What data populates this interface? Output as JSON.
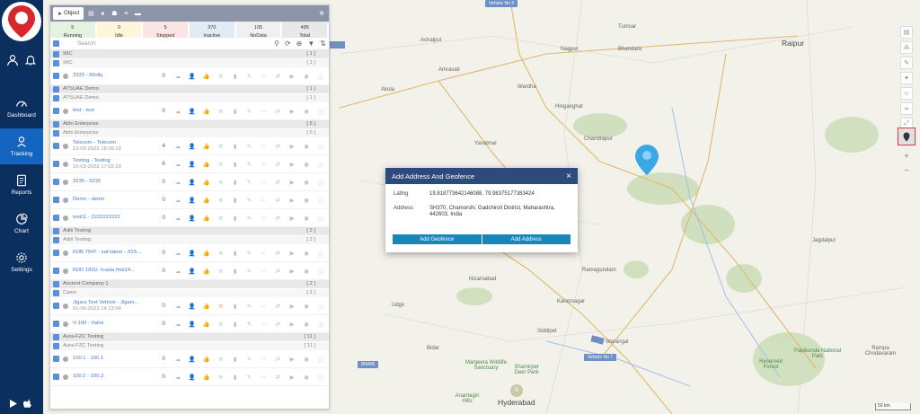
{
  "sidebar": {
    "items": [
      {
        "label": "Dashboard",
        "icon": "speedometer-icon",
        "active": false
      },
      {
        "label": "Tracking",
        "icon": "location-person-icon",
        "active": true
      },
      {
        "label": "Reports",
        "icon": "report-icon",
        "active": false
      },
      {
        "label": "Chart",
        "icon": "pie-chart-icon",
        "active": false
      },
      {
        "label": "Settings",
        "icon": "gear-icon",
        "active": false
      }
    ]
  },
  "panel": {
    "tab_label": "Object",
    "status": [
      {
        "count": "5",
        "label": "Running",
        "bg": "#e3f3e0"
      },
      {
        "count": "0",
        "label": "Idle",
        "bg": "#fdf6dc"
      },
      {
        "count": "5",
        "label": "Stopped",
        "bg": "#fbe4e4"
      },
      {
        "count": "370",
        "label": "Inactive",
        "bg": "#e1ebf6"
      },
      {
        "count": "105",
        "label": "NoData",
        "bg": "#f0f0f0"
      },
      {
        "count": "495",
        "label": "Total",
        "bg": "#e8e8e8"
      }
    ],
    "search_placeholder": "Search",
    "rows": [
      {
        "type": "grp",
        "name": "99C",
        "count": "[ 1 ]"
      },
      {
        "type": "sub",
        "name": "99C",
        "count": "[ 1 ]"
      },
      {
        "type": "veh",
        "name": "3333 - 99olkj",
        "time": "",
        "speed": "0"
      },
      {
        "type": "grp",
        "name": "ATSUAE Demo",
        "count": "[ 1 ]"
      },
      {
        "type": "sub",
        "name": "ATSUAE Demo",
        "count": "[ 1 ]"
      },
      {
        "type": "veh",
        "name": "test - test",
        "time": "",
        "speed": "0"
      },
      {
        "type": "grp",
        "name": "Abhi Enterprise",
        "count": "[ 5 ]"
      },
      {
        "type": "sub",
        "name": "Abhi Enterprise",
        "count": "[ 5 ]"
      },
      {
        "type": "veh",
        "name": "Telecom - Telecom",
        "time": "13-03-2023 18:39:19",
        "speed": "4",
        "tall": true
      },
      {
        "type": "veh",
        "name": "Testing - Testing",
        "time": "10-03-2022 17:03:29",
        "speed": "6",
        "red": true
      },
      {
        "type": "veh",
        "name": "3235 - 3235",
        "time": "",
        "speed": "0"
      },
      {
        "type": "veh",
        "name": "Demo - demo",
        "time": "",
        "speed": "0"
      },
      {
        "type": "veh",
        "name": "test11 - 2222222222",
        "time": "",
        "speed": "0"
      },
      {
        "type": "grp",
        "name": "Aditi Testing",
        "count": "[ 2 ]"
      },
      {
        "type": "sub",
        "name": "Aditi Testing",
        "count": "[ 2 ]"
      },
      {
        "type": "veh",
        "name": "KDB 794T - saf latest - JOS...",
        "time": "",
        "speed": "0"
      },
      {
        "type": "veh",
        "name": "KDD 183U -Icasia fmb14...",
        "time": "",
        "speed": "0"
      },
      {
        "type": "grp",
        "name": "Ancient Company 1",
        "count": "[ 2 ]"
      },
      {
        "type": "sub",
        "name": "Camx",
        "count": "[ 2 ]"
      },
      {
        "type": "veh",
        "name": "Jigars Test Vehicle - Jigars...",
        "time": "01-06-2023 14:13:54",
        "speed": "0",
        "red": true,
        "orange": true
      },
      {
        "type": "veh",
        "name": "V-100 - Vatrix",
        "time": "",
        "speed": "0"
      },
      {
        "type": "grp",
        "name": "Aura-FZC Testing",
        "count": "[ 11 ]"
      },
      {
        "type": "sub",
        "name": "Aura-FZC Testing",
        "count": "[ 11 ]"
      },
      {
        "type": "veh",
        "name": "100.1 - 100.1",
        "time": "",
        "speed": "0"
      },
      {
        "type": "veh",
        "name": "100.2 - 100.2",
        "time": "",
        "speed": "0"
      }
    ]
  },
  "dialog": {
    "title": "Add Address And Geofence",
    "latlng_label": "Latlng",
    "latlng_value": "19.818773642146088, 79.98375177383424",
    "address_label": "Address",
    "address_value": "SH370, Chamorshi, Gadchiroli District, Maharashtra, 442603, India",
    "btn_geofence": "Add Geofence",
    "btn_address": "Add Address"
  },
  "map": {
    "vehicle_labels": [
      "Vehicle No 3",
      "Vehicle No 7",
      "BN495"
    ],
    "cluster_count": "6",
    "scale": "50 km",
    "cities": [
      {
        "name": "Raipur",
        "big": true
      },
      {
        "name": "Nagpur"
      },
      {
        "name": "Bhandara"
      },
      {
        "name": "Tumsar"
      },
      {
        "name": "Achalpur"
      },
      {
        "name": "Amravati"
      },
      {
        "name": "Wardha"
      },
      {
        "name": "Akola"
      },
      {
        "name": "Hinganghat"
      },
      {
        "name": "Yavatmal"
      },
      {
        "name": "Chandrapur"
      },
      {
        "name": "Jagdalpur"
      },
      {
        "name": "Nizamabad"
      },
      {
        "name": "Ramagundam"
      },
      {
        "name": "Karimnagar"
      },
      {
        "name": "Udgir"
      },
      {
        "name": "Siddipet"
      },
      {
        "name": "Warangal"
      },
      {
        "name": "Bidar"
      },
      {
        "name": "Manjeera Wildlife Sanctuary"
      },
      {
        "name": "Shamirpet Deer Park"
      },
      {
        "name": "Anantagiri Hills"
      },
      {
        "name": "Hyderabad",
        "big": true
      },
      {
        "name": "Papikonda National Park"
      },
      {
        "name": "Rampa Chodavaram"
      },
      {
        "name": "Reserved Forest"
      }
    ]
  }
}
